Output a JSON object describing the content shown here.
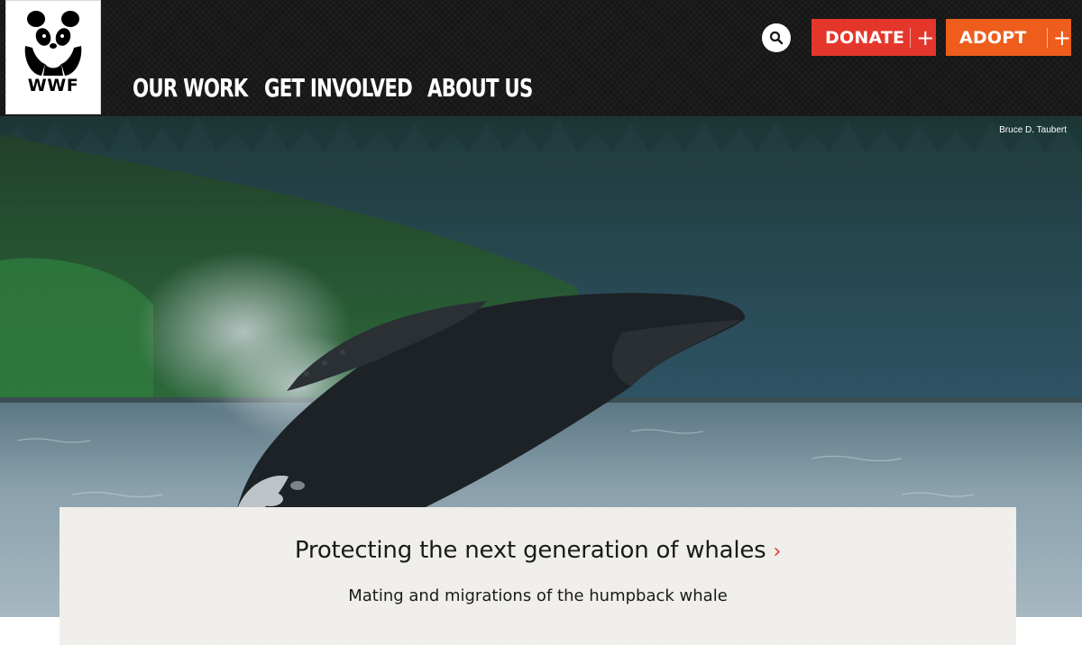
{
  "logo": {
    "text": "WWF",
    "icon": "panda-icon"
  },
  "nav": {
    "items": [
      "OUR WORK",
      "GET INVOLVED",
      "ABOUT US"
    ]
  },
  "header_actions": {
    "search_icon": "search-icon",
    "donate_label": "DONATE",
    "adopt_label": "ADOPT",
    "plus": "+"
  },
  "hero": {
    "photo_credit": "Bruce D. Taubert",
    "image_subject": "humpback-whale-breaching"
  },
  "feature": {
    "title": "Protecting the next generation of whales",
    "chevron": "›",
    "subtitle": "Mating and migrations of the humpback whale"
  },
  "colors": {
    "header_bg": "#161616",
    "donate": "#e5362b",
    "adopt": "#ee5d1b",
    "card_bg": "#f2f0ec"
  }
}
